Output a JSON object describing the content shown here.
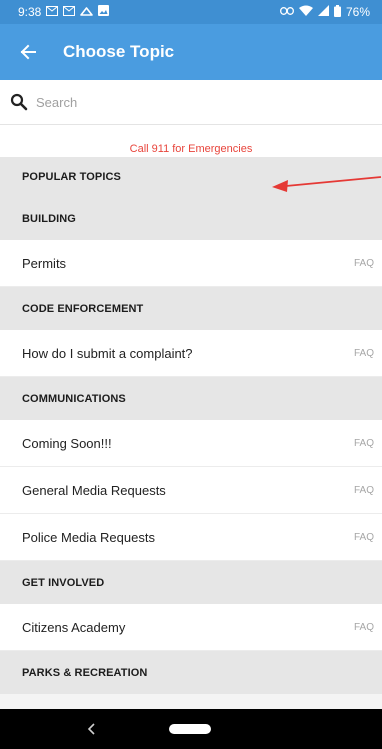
{
  "status_bar": {
    "time": "9:38",
    "left_icons": [
      "mail-icon",
      "mail-icon",
      "cloud-icon",
      "image-icon"
    ],
    "right_icons": [
      "link-icon",
      "wifi-icon",
      "signal-icon",
      "battery-icon"
    ],
    "battery": "76%"
  },
  "app_bar": {
    "title": "Choose Topic",
    "background": "#4a9ce0"
  },
  "search": {
    "placeholder": "Search"
  },
  "emergency_notice": "Call 911 for Emergencies",
  "sections": [
    {
      "title": "POPULAR TOPICS",
      "items": []
    },
    {
      "title": "BUILDING",
      "items": [
        {
          "label": "Permits",
          "tag": "FAQ"
        }
      ]
    },
    {
      "title": "CODE ENFORCEMENT",
      "items": [
        {
          "label": "How do I submit a complaint?",
          "tag": "FAQ"
        }
      ]
    },
    {
      "title": "COMMUNICATIONS",
      "items": [
        {
          "label": "Coming Soon!!!",
          "tag": "FAQ"
        },
        {
          "label": "General Media Requests",
          "tag": "FAQ"
        },
        {
          "label": "Police Media Requests",
          "tag": "FAQ"
        }
      ]
    },
    {
      "title": "GET INVOLVED",
      "items": [
        {
          "label": "Citizens Academy",
          "tag": "FAQ"
        }
      ]
    },
    {
      "title": "PARKS & RECREATION",
      "items": []
    }
  ],
  "colors": {
    "accent": "#4a9ce0",
    "status_bar": "#3f8fd2",
    "emergency": "#e8453c",
    "annotation": "#e53935"
  }
}
